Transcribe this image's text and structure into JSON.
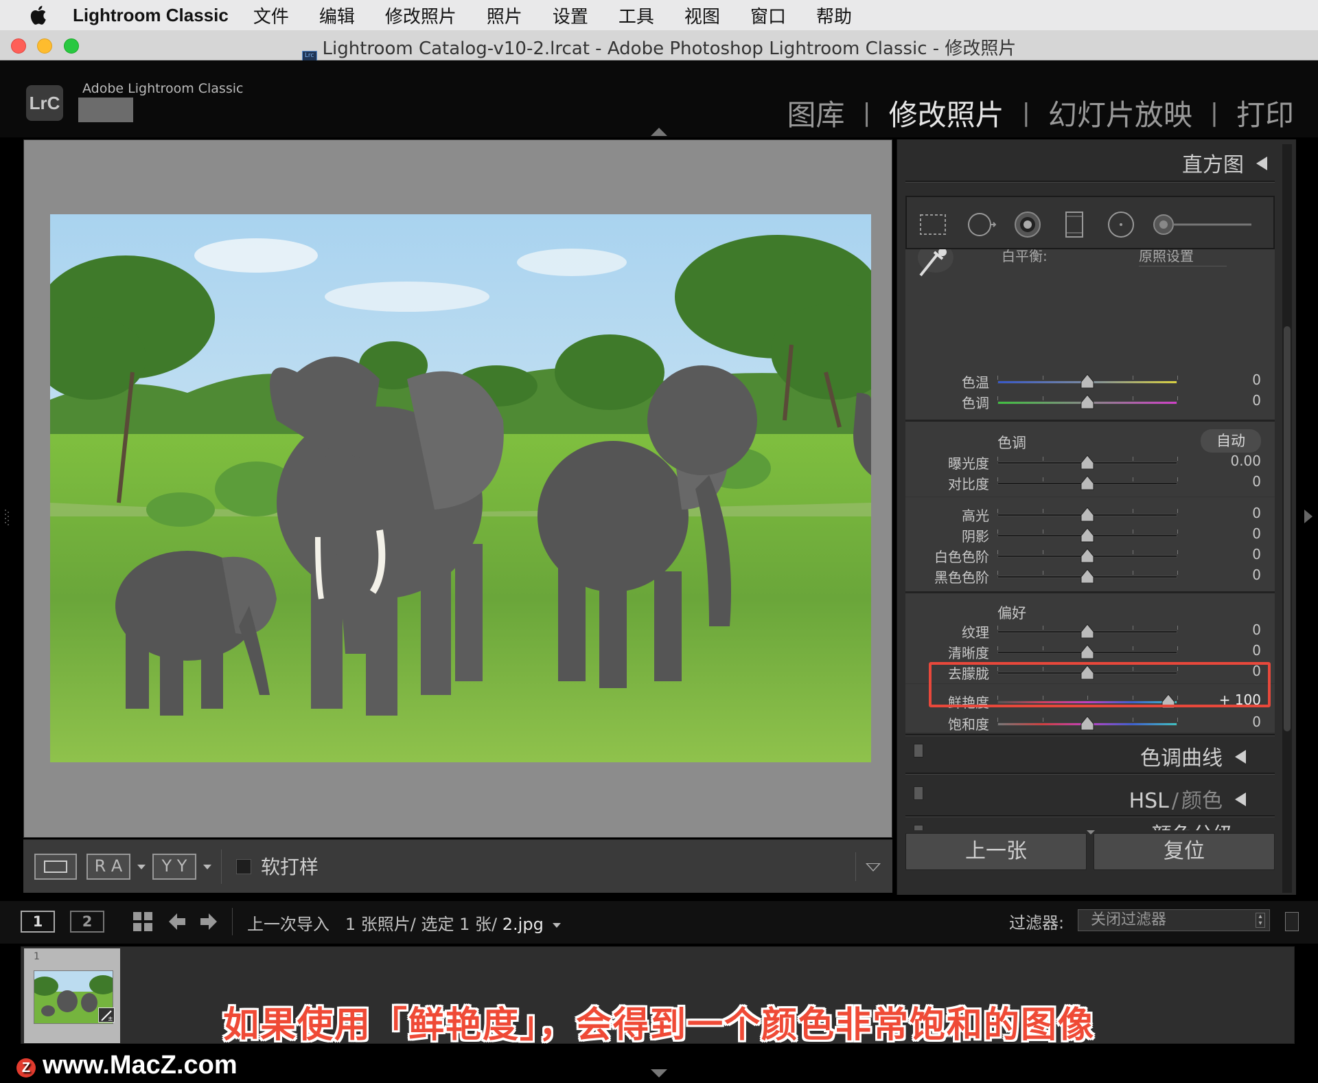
{
  "menubar": {
    "app": "Lightroom Classic",
    "items": [
      "文件",
      "编辑",
      "修改照片",
      "照片",
      "设置",
      "工具",
      "视图",
      "窗口",
      "帮助"
    ]
  },
  "window": {
    "title": "Lightroom Catalog-v10-2.lrcat - Adobe Photoshop Lightroom Classic - 修改照片",
    "doc_icon": "Lrc"
  },
  "header": {
    "logo": "LrC",
    "brand": "Adobe Lightroom Classic",
    "modules": [
      "图库",
      "修改照片",
      "幻灯片放映",
      "打印"
    ],
    "active_module": 1
  },
  "toolbar": {
    "softproof": "软打样",
    "ra": "R A",
    "yy": "Y Y"
  },
  "right_panel": {
    "histogram": "直方图",
    "wb_label_partial": "白平衡:",
    "wb_value_partial": "原照设置",
    "sliders_wb": [
      {
        "label": "色温",
        "value": "0",
        "pos": 0.5
      },
      {
        "label": "色调",
        "value": "0",
        "pos": 0.5
      }
    ],
    "tone_section": "色调",
    "auto": "自动",
    "sliders_tone": [
      {
        "label": "曝光度",
        "value": "0.00",
        "pos": 0.5
      },
      {
        "label": "对比度",
        "value": "0",
        "pos": 0.5
      }
    ],
    "sliders_tone2": [
      {
        "label": "高光",
        "value": "0",
        "pos": 0.5
      },
      {
        "label": "阴影",
        "value": "0",
        "pos": 0.5
      },
      {
        "label": "白色色阶",
        "value": "0",
        "pos": 0.5
      },
      {
        "label": "黑色色阶",
        "value": "0",
        "pos": 0.5
      }
    ],
    "presence_section": "偏好",
    "sliders_presence": [
      {
        "label": "纹理",
        "value": "0",
        "pos": 0.5
      },
      {
        "label": "清晰度",
        "value": "0",
        "pos": 0.5
      },
      {
        "label": "去朦胧",
        "value": "0",
        "pos": 0.5
      }
    ],
    "vibrance": {
      "label": "鲜艳度",
      "value": "+ 100",
      "pos": 0.95
    },
    "saturation": {
      "label": "饱和度",
      "value": "0",
      "pos": 0.5
    },
    "tone_curve": "色调曲线",
    "hsl_a": "HSL",
    "hsl_sep": "/",
    "hsl_b": "颜色",
    "color_grading_partial": "颜色分级",
    "prev": "上一张",
    "reset": "复位"
  },
  "filmbar": {
    "view1": "1",
    "view2": "2",
    "source": "上一次导入",
    "count": "1 张照片/ 选定 1 张/",
    "file": "2.jpg",
    "filter_label": "过滤器:",
    "filter_value": "关闭过滤器"
  },
  "filmstrip": {
    "index": "1"
  },
  "caption": "如果使用「鲜艳度」，会得到一个颜色非常饱和的图像",
  "watermark": "www.MacZ.com",
  "watermark_logo": "Z"
}
